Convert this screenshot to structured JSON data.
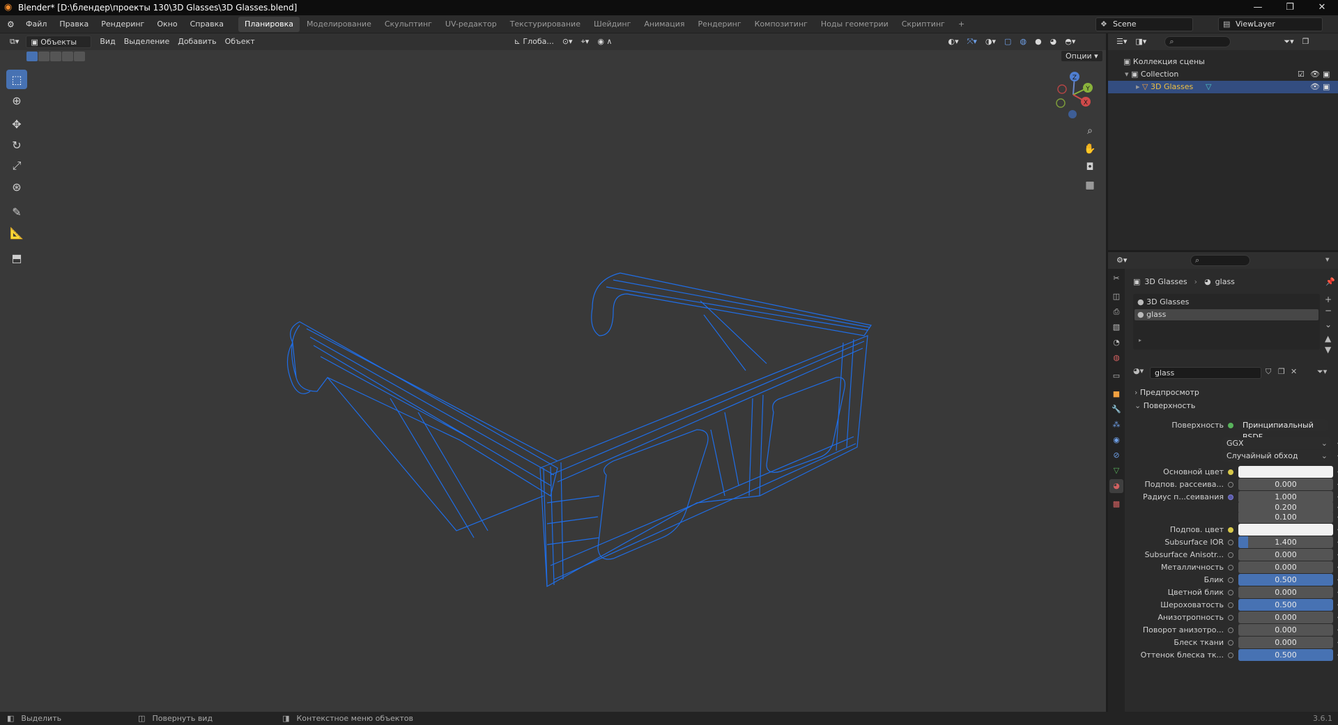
{
  "window": {
    "title": "Blender* [D:\\блендер\\проекты 130\\3D Glasses\\3D Glasses.blend]",
    "controls": [
      "—",
      "❐",
      "✕"
    ]
  },
  "menus": [
    "Файл",
    "Правка",
    "Рендеринг",
    "Окно",
    "Справка"
  ],
  "workspaces": {
    "active": "Планировка",
    "items": [
      "Планировка",
      "Моделирование",
      "Скульптинг",
      "UV-редактор",
      "Текстурирование",
      "Шейдинг",
      "Анимация",
      "Рендеринг",
      "Композитинг",
      "Ноды геометрии",
      "Скриптинг",
      "+"
    ]
  },
  "scene": {
    "name": "Scene",
    "view_layer": "ViewLayer"
  },
  "viewport": {
    "mode": "Объекты",
    "header_menus": [
      "Вид",
      "Выделение",
      "Добавить",
      "Объект"
    ],
    "orientation": "Глоба...",
    "options": "Опции",
    "gizmo": {
      "z": "Z",
      "y": "Y",
      "x": "X"
    },
    "wire_color": "#1f6ee8"
  },
  "outliner": {
    "root": "Коллекция сцены",
    "collection": "Collection",
    "object": "3D Glasses"
  },
  "properties": {
    "breadcrumb": {
      "object": "3D Glasses",
      "material": "glass"
    },
    "material_slots": [
      "3D Glasses",
      "glass"
    ],
    "material_name": "glass",
    "panels": {
      "preview": "Предпросмотр",
      "surface": "Поверхность"
    },
    "surface_label": "Поверхность",
    "surface_value": "Принципиальный BSDF",
    "distribution": "GGX",
    "subsurface_method": "Случайный обход",
    "rows": [
      {
        "label": "Основной цвет",
        "value": "",
        "type": "color",
        "dot": "y"
      },
      {
        "label": "Подпов. рассеива...",
        "value": "0.000",
        "fill": 0,
        "dot": "n"
      },
      {
        "label": "Радиус п...сеивания",
        "value": "1.000",
        "fill": 0,
        "dot": "b"
      },
      {
        "label": "",
        "value": "0.200",
        "fill": 0,
        "dot": "none"
      },
      {
        "label": "",
        "value": "0.100",
        "fill": 0,
        "dot": "none"
      },
      {
        "label": "Подпов. цвет",
        "value": "",
        "type": "color",
        "dot": "y"
      },
      {
        "label": "Subsurface IOR",
        "value": "1.400",
        "fill": 0.1,
        "dot": "n"
      },
      {
        "label": "Subsurface Anisotr...",
        "value": "0.000",
        "fill": 0,
        "dot": "n"
      },
      {
        "label": "Металличность",
        "value": "0.000",
        "fill": 0,
        "dot": "n"
      },
      {
        "label": "Блик",
        "value": "0.500",
        "fill": 1,
        "dot": "n"
      },
      {
        "label": "Цветной блик",
        "value": "0.000",
        "fill": 0,
        "dot": "n"
      },
      {
        "label": "Шероховатость",
        "value": "0.500",
        "fill": 1,
        "dot": "n"
      },
      {
        "label": "Анизотропность",
        "value": "0.000",
        "fill": 0,
        "dot": "n"
      },
      {
        "label": "Поворот анизотро...",
        "value": "0.000",
        "fill": 0,
        "dot": "n"
      },
      {
        "label": "Блеск ткани",
        "value": "0.000",
        "fill": 0,
        "dot": "n"
      },
      {
        "label": "Оттенок блеска тк...",
        "value": "0.500",
        "fill": 1,
        "dot": "n"
      }
    ]
  },
  "status": {
    "select": "Выделить",
    "rotate": "Повернуть вид",
    "context": "Контекстное меню объектов",
    "version": "3.6.1"
  }
}
